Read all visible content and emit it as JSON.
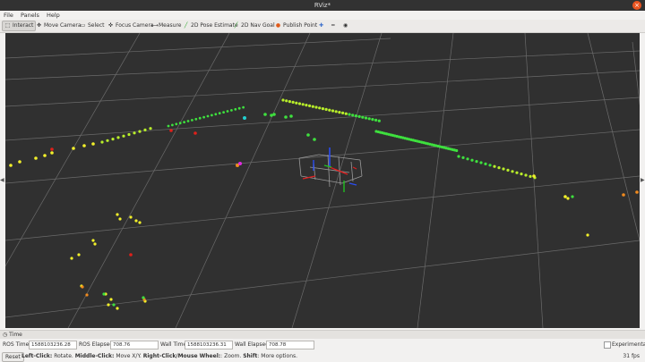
{
  "window": {
    "title": "RViz*",
    "close_glyph": "×"
  },
  "menu": [
    "File",
    "Panels",
    "Help"
  ],
  "toolbar": {
    "tools": [
      {
        "label": "Interact",
        "icon": "interact-icon",
        "glyph": "⬚",
        "active": true
      },
      {
        "label": "Move Camera",
        "icon": "move-camera-icon",
        "glyph": "✥"
      },
      {
        "label": "Select",
        "icon": "select-icon",
        "glyph": "▭"
      },
      {
        "label": "Focus Camera",
        "icon": "focus-camera-icon",
        "glyph": "✜"
      },
      {
        "label": "Measure",
        "icon": "measure-icon",
        "glyph": "⟷"
      },
      {
        "label": "2D Pose Estimate",
        "icon": "pose-estimate-icon",
        "glyph": "╱"
      },
      {
        "label": "2D Nav Goal",
        "icon": "nav-goal-icon",
        "glyph": "╱"
      },
      {
        "label": "Publish Point",
        "icon": "publish-point-icon",
        "glyph": "●"
      }
    ],
    "extra_icons": [
      {
        "name": "add-tool-icon",
        "glyph": "✚"
      },
      {
        "name": "remove-tool-icon",
        "glyph": "━"
      },
      {
        "name": "tool-options-icon",
        "glyph": "◉"
      }
    ],
    "pose_color": "#2fa82f",
    "publish_color": "#e05a1a"
  },
  "time_panel": {
    "title": "Time",
    "ros_time_label": "ROS Time:",
    "ros_time": "1588103236.28",
    "ros_elapsed_label": "ROS Elapsed:",
    "ros_elapsed": "708.76",
    "wall_time_label": "Wall Time:",
    "wall_time": "1588103236.31",
    "wall_elapsed_label": "Wall Elapsed:",
    "wall_elapsed": "708.78",
    "experimental_label": "Experimental"
  },
  "status": {
    "reset_label": "Reset",
    "hint_parts": [
      {
        "text": "Left-Click:",
        "bold": true
      },
      {
        "text": " Rotate. ",
        "bold": false
      },
      {
        "text": "Middle-Click:",
        "bold": true
      },
      {
        "text": " Move X/Y. ",
        "bold": false
      },
      {
        "text": "Right-Click/Mouse Wheel:",
        "bold": true
      },
      {
        "text": ": Zoom. ",
        "bold": false
      },
      {
        "text": "Shift",
        "bold": true
      },
      {
        "text": ": More options.",
        "bold": false
      }
    ],
    "fps": "31 fps"
  },
  "viewport": {
    "background": "#303030",
    "grid_color": "#6a6a6a",
    "point_colors": {
      "green": "#3ee03e",
      "lime": "#b8ee2a",
      "yellow": "#f2f02a",
      "orange": "#f08a1e",
      "red": "#e0201a",
      "cyan": "#22d0d0",
      "magenta": "#e02ae0"
    }
  }
}
